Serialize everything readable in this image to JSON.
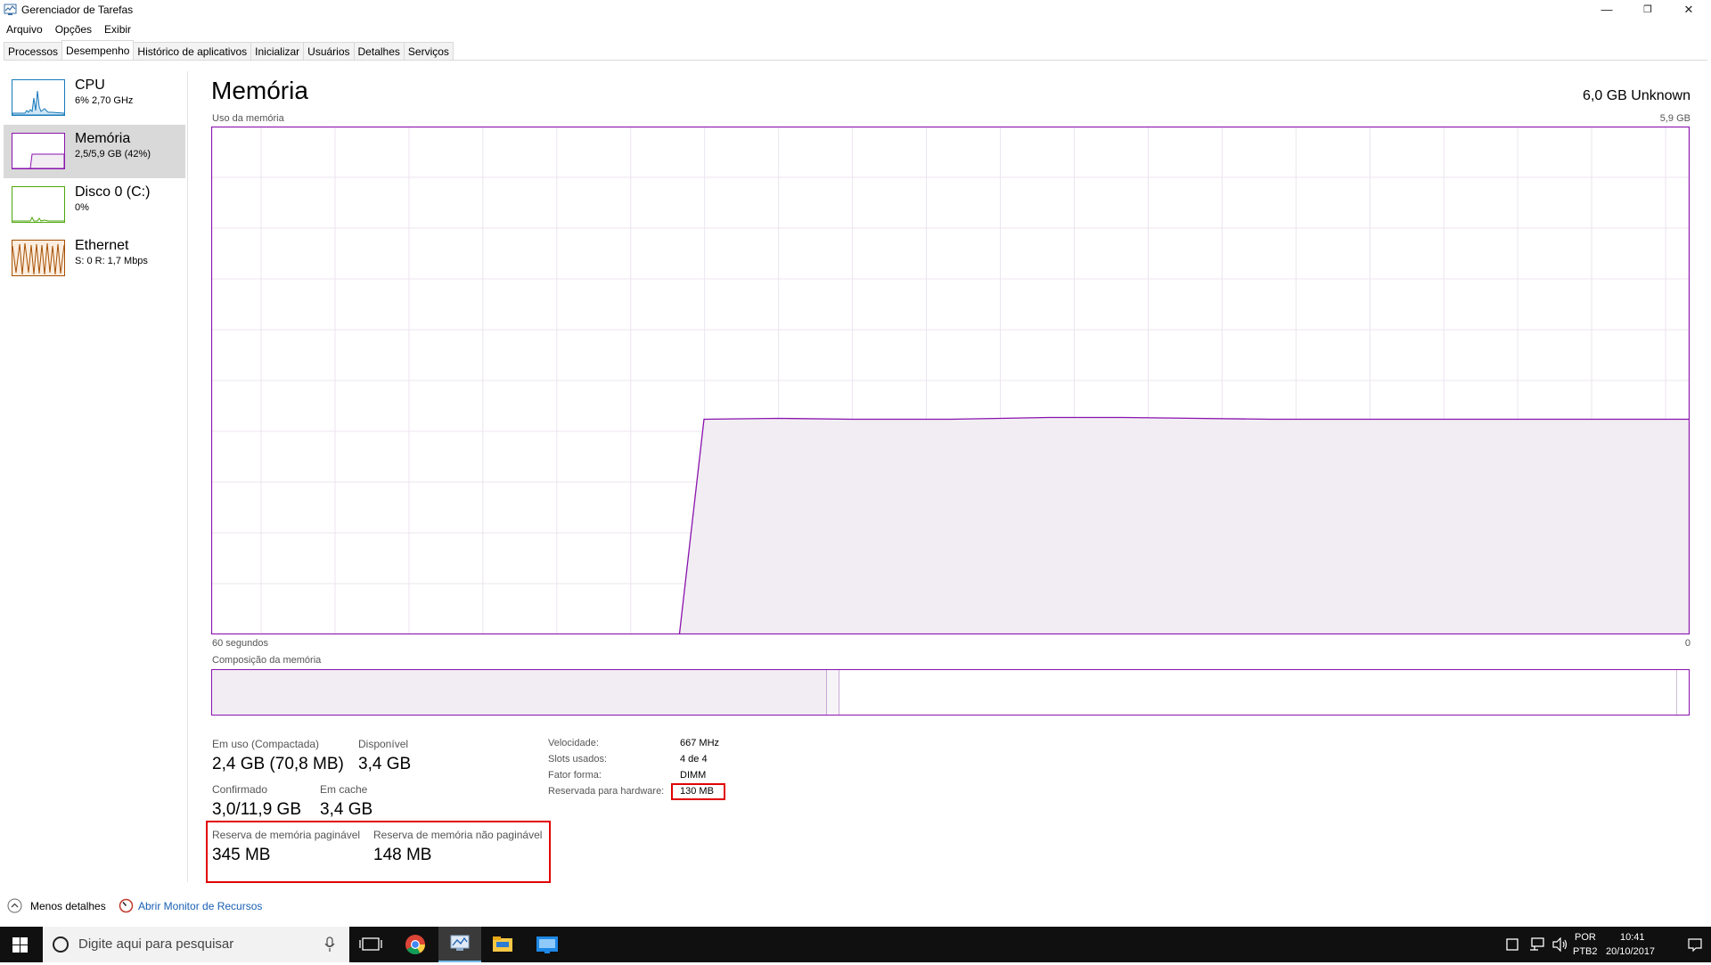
{
  "window": {
    "title": "Gerenciador de Tarefas",
    "controls": [
      "—",
      "❐",
      "✕"
    ]
  },
  "menu": [
    "Arquivo",
    "Opções",
    "Exibir"
  ],
  "tabs": [
    "Processos",
    "Desempenho",
    "Histórico de aplicativos",
    "Inicializar",
    "Usuários",
    "Detalhes",
    "Serviços"
  ],
  "sidebar": {
    "items": [
      {
        "name": "CPU",
        "value": "6% 2,70 GHz",
        "color": "#1779ba"
      },
      {
        "name": "Memória",
        "value": "2,5/5,9 GB (42%)",
        "color": "#8b12ae"
      },
      {
        "name": "Disco 0 (C:)",
        "value": "0%",
        "color": "#4da60c"
      },
      {
        "name": "Ethernet",
        "value": "S: 0 R: 1,7 Mbps",
        "color": "#a74f01"
      }
    ]
  },
  "main": {
    "title": "Memória",
    "total": "6,0 GB Unknown",
    "usage_label": "Uso da memória",
    "usage_max": "5,9 GB",
    "time_label": "60 segundos",
    "time_end": "0",
    "composition_label": "Composição da memória",
    "accent": "#8b12ae"
  },
  "chart_data": {
    "type": "area",
    "title": "Uso da memória",
    "xlabel": "60 segundos",
    "ylabel": "",
    "ylim": [
      0,
      5.9
    ],
    "x": [
      60,
      41,
      40,
      37,
      34,
      30,
      26,
      23,
      20,
      17,
      14,
      10,
      7,
      4,
      0
    ],
    "values": [
      0,
      0,
      2.5,
      2.51,
      2.5,
      2.5,
      2.52,
      2.52,
      2.51,
      2.5,
      2.5,
      2.5,
      2.5,
      2.5,
      2.5
    ]
  },
  "stats": {
    "em_uso_label": "Em uso (Compactada)",
    "em_uso_value": "2,4 GB (70,8 MB)",
    "disponivel_label": "Disponível",
    "disponivel_value": "3,4 GB",
    "confirmado_label": "Confirmado",
    "confirmado_value": "3,0/11,9 GB",
    "em_cache_label": "Em cache",
    "em_cache_value": "3,4 GB",
    "paginavel_label": "Reserva de memória paginável",
    "paginavel_value": "345 MB",
    "nao_paginavel_label": "Reserva de memória não paginável",
    "nao_paginavel_value": "148 MB"
  },
  "details": {
    "velocidade_label": "Velocidade:",
    "velocidade_value": "667 MHz",
    "slots_label": "Slots usados:",
    "slots_value": "4 de 4",
    "fator_label": "Fator forma:",
    "fator_value": "DIMM",
    "reservada_label": "Reservada para hardware:",
    "reservada_value": "130 MB"
  },
  "footer": {
    "menos_detalhes": "Menos detalhes",
    "abrir_monitor": "Abrir Monitor de Recursos"
  },
  "taskbar": {
    "search_placeholder": "Digite aqui para pesquisar",
    "lang1": "POR",
    "lang2": "PTB2",
    "time": "10:41",
    "date": "20/10/2017"
  }
}
